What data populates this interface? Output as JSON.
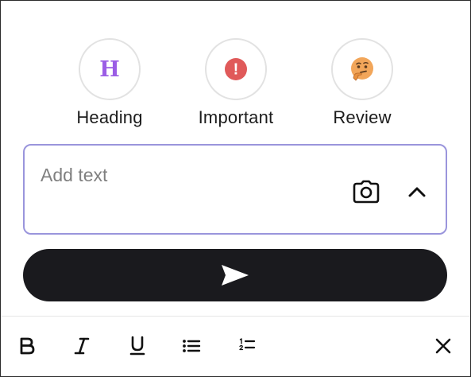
{
  "chips": [
    {
      "label": "Heading",
      "glyph": "H",
      "icon": "heading-icon",
      "color": "#9b5de5"
    },
    {
      "label": "Important",
      "glyph": "!",
      "icon": "exclamation-icon",
      "color": "#e05a5a"
    },
    {
      "label": "Review",
      "icon": "thinking-face-icon",
      "color": "#f2a65a"
    }
  ],
  "composer": {
    "value": "",
    "placeholder": "Add text",
    "border_color": "#9a95dc",
    "camera_icon": "camera-icon",
    "collapse_icon": "chevron-up-icon"
  },
  "send": {
    "icon": "send-icon",
    "background": "#1a1a1e"
  },
  "toolbar": {
    "items": [
      {
        "name": "bold",
        "icon": "bold-icon"
      },
      {
        "name": "italic",
        "icon": "italic-icon"
      },
      {
        "name": "underline",
        "icon": "underline-icon"
      },
      {
        "name": "bulleted-list",
        "icon": "bulleted-list-icon"
      },
      {
        "name": "numbered-list",
        "icon": "numbered-list-icon"
      },
      {
        "name": "close",
        "icon": "close-icon"
      }
    ]
  }
}
